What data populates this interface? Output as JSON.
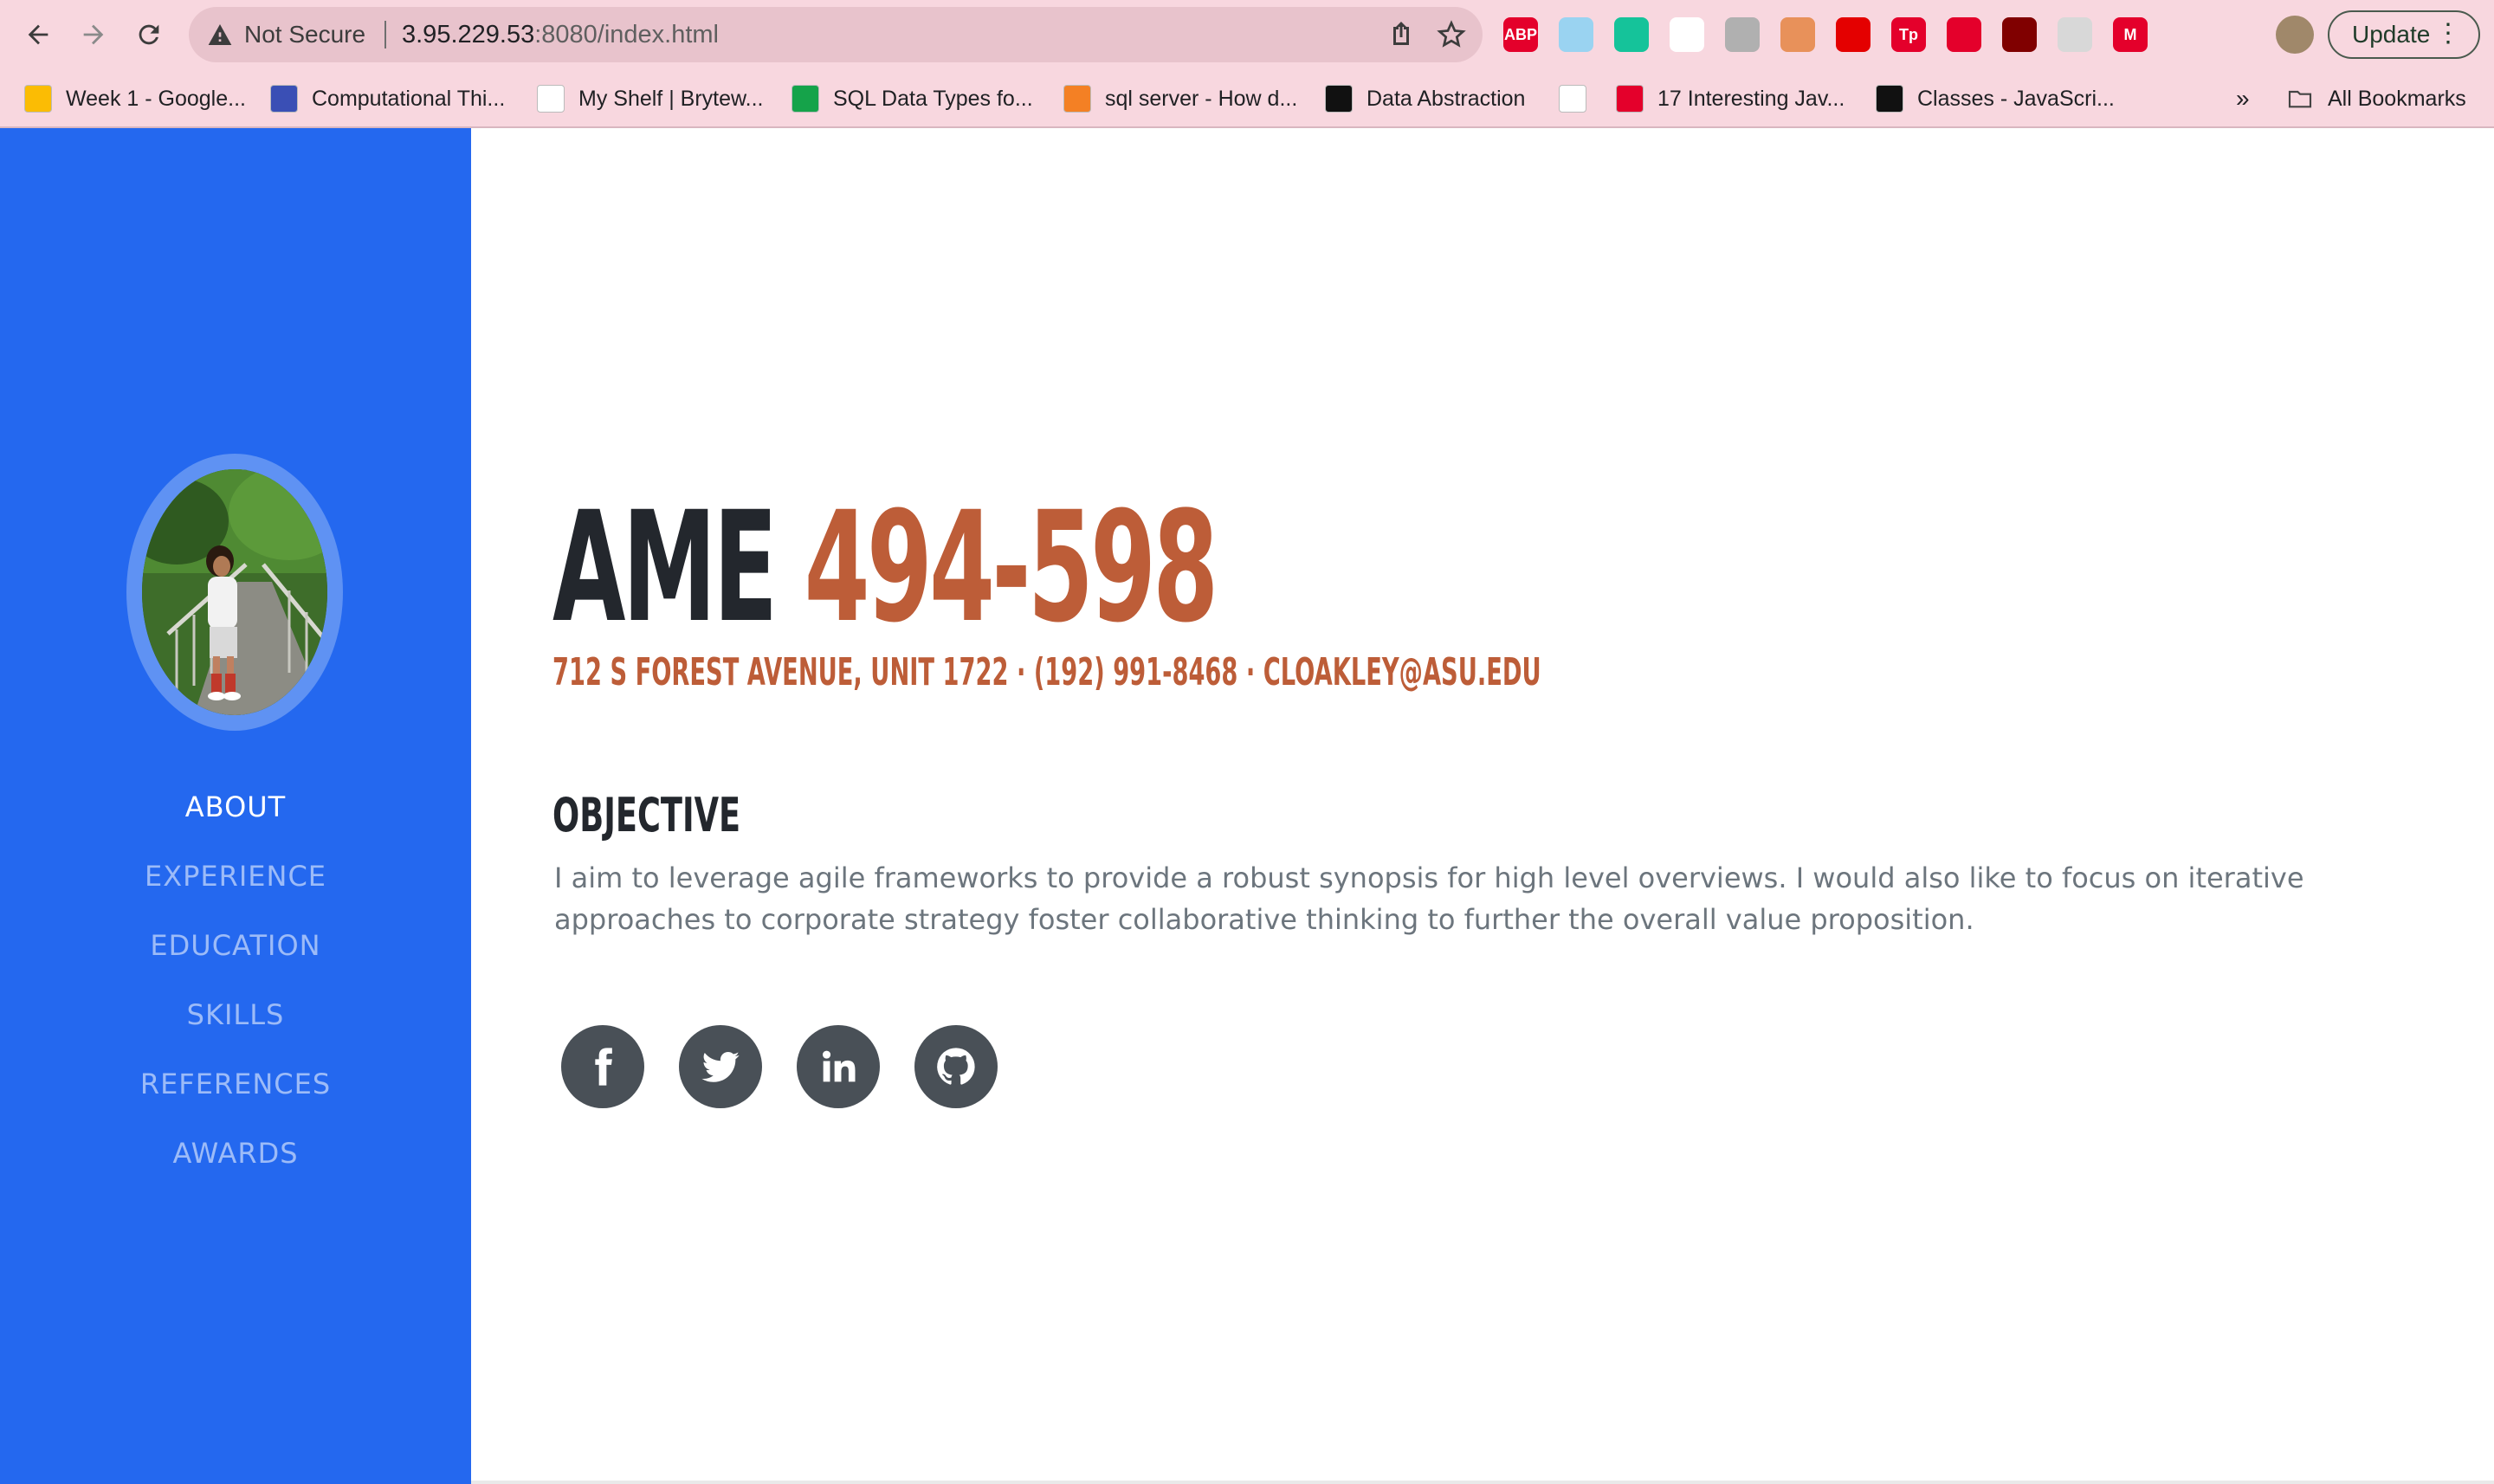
{
  "browser": {
    "security_label": "Not Secure",
    "url_host": "3.95.229.53",
    "url_rest": ":8080/index.html",
    "update_label": "Update",
    "extensions": [
      {
        "icon": "adblock-icon",
        "label": "ABP",
        "color": "#e4002b"
      },
      {
        "icon": "extension-icon",
        "label": "",
        "color": "#9ad3f1"
      },
      {
        "icon": "grammarly-icon",
        "label": "",
        "color": "#15c39a"
      },
      {
        "icon": "speed-icon",
        "label": "",
        "color": "#ffffff"
      },
      {
        "icon": "extension-icon",
        "label": "",
        "color": "#b0b0b0"
      },
      {
        "icon": "extension-icon",
        "label": "",
        "color": "#e8915a"
      },
      {
        "icon": "youtube-icon",
        "label": "",
        "color": "#e40000"
      },
      {
        "icon": "tp-icon",
        "label": "Tp",
        "color": "#e4002b"
      },
      {
        "icon": "dislike-icon",
        "label": "",
        "color": "#e4002b"
      },
      {
        "icon": "ublock-icon",
        "label": "",
        "color": "#800000"
      },
      {
        "icon": "react-icon",
        "label": "",
        "color": "#d8d8d8"
      },
      {
        "icon": "m-icon",
        "label": "M",
        "color": "#e4002b"
      },
      {
        "icon": "puzzle-icon",
        "label": "",
        "color": "#000000"
      },
      {
        "icon": "sidepanel-icon",
        "label": "",
        "color": "#000000"
      }
    ],
    "bookmarks": [
      {
        "label": "Week 1 - Google...",
        "icon": "google-drive-icon"
      },
      {
        "label": "Computational Thi...",
        "icon": "forms-icon"
      },
      {
        "label": "My Shelf | Brytew...",
        "icon": "document-icon"
      },
      {
        "label": "SQL Data Types fo...",
        "icon": "w3schools-icon"
      },
      {
        "label": "sql server - How d...",
        "icon": "stackoverflow-icon"
      },
      {
        "label": "Data Abstraction",
        "icon": "princeton-icon"
      },
      {
        "label": "",
        "icon": "t-logo-icon"
      },
      {
        "label": "17 Interesting Jav...",
        "icon": "arrow-logo-icon"
      },
      {
        "label": "Classes - JavaScri...",
        "icon": "mdn-icon"
      }
    ],
    "overflow_label": "»",
    "all_bookmarks_label": "All Bookmarks"
  },
  "sidebar": {
    "nav": [
      {
        "label": "ABOUT",
        "active": true
      },
      {
        "label": "EXPERIENCE",
        "active": false
      },
      {
        "label": "EDUCATION",
        "active": false
      },
      {
        "label": "SKILLS",
        "active": false
      },
      {
        "label": "REFERENCES",
        "active": false
      },
      {
        "label": "AWARDS",
        "active": false
      }
    ]
  },
  "about": {
    "first_name": "AME",
    "last_name": "494-598",
    "contact": "712 S Forest Avenue, Unit 1722 · (192) 991-8468 · ",
    "email": "cloakley@asu.edu",
    "objective_title": "OBJECTIVE",
    "objective_text": "I aim to leverage agile frameworks to provide a robust synopsis for high level overviews. I would also like to focus on iterative approaches to corporate strategy foster collaborative thinking to further the overall value proposition."
  },
  "social": [
    {
      "name": "facebook-icon"
    },
    {
      "name": "twitter-icon"
    },
    {
      "name": "linkedin-icon"
    },
    {
      "name": "github-icon"
    }
  ],
  "colors": {
    "sidebar_bg": "#2468ef",
    "accent": "#bd5d38",
    "heading": "#23272d",
    "body_text": "#6c757d",
    "chrome_bg": "#f8d7df"
  }
}
